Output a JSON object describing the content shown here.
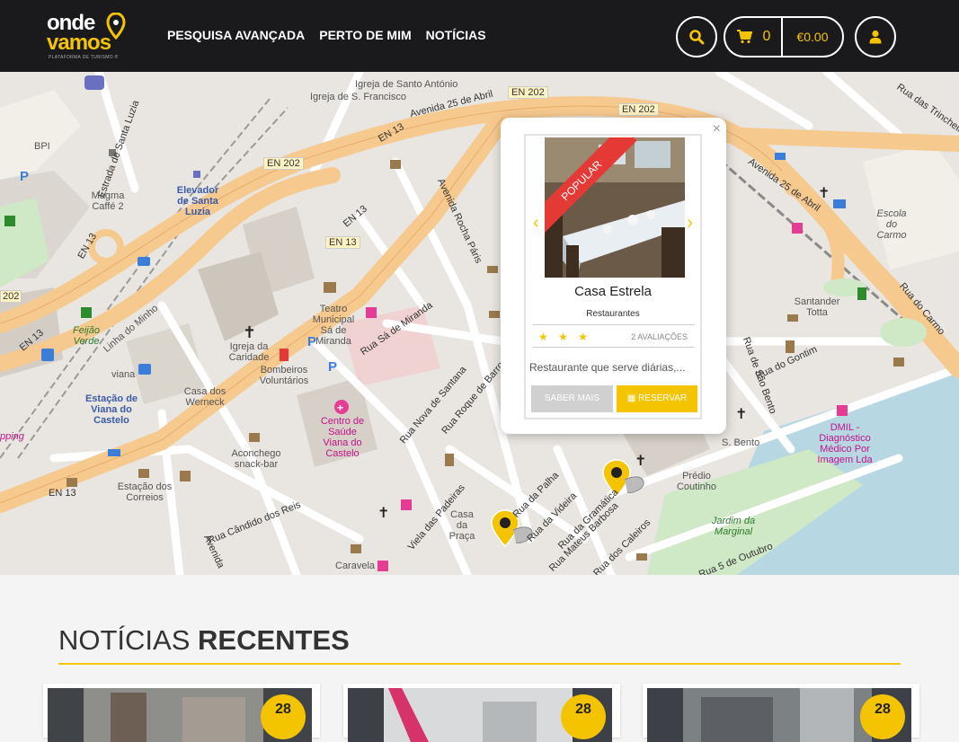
{
  "brand": {
    "line1": "onde",
    "line2": "vamos",
    "tagline": "PLATAFORMA DE TURISMO ®"
  },
  "nav": [
    {
      "label": "PESQUISA AVANÇADA"
    },
    {
      "label": "PERTO DE MIM"
    },
    {
      "label": "NOTÍCIAS"
    }
  ],
  "cart": {
    "count": "0",
    "total": "€0.00"
  },
  "icons": {
    "search": "search-icon",
    "cart": "cart-icon",
    "user": "user-icon"
  },
  "colors": {
    "accent": "#f5c400",
    "header": "#1a1a1c",
    "ribbon": "#e53935"
  },
  "map": {
    "labels": {
      "igreja_sf": "Igreja de S. Francisco",
      "igreja_sa": "Igreja de Santo António",
      "av25": "Avenida 25 de Abril",
      "en202a": "EN 202",
      "en202b": "EN 202",
      "en202c": "EN 202",
      "en13a": "EN 13",
      "en13b": "EN 13",
      "en13c": "EN 13",
      "en13d": "EN 13",
      "en13e": "EN 13",
      "en13f": "EN 13",
      "estrada": "Estrada de Santa Luzia",
      "bpi": "BPI",
      "magma": "Magma Caffé 2",
      "elevador": "Elevador de Santa Luzia",
      "teatro": "Teatro Municipal Sá de Miranda",
      "rua_sa": "Rua Sá de Miranda",
      "igreja_caridade": "Igreja da Caridade",
      "bombeiros": "Bombeiros Voluntários",
      "casa_werneck": "Casa dos Werneck",
      "centro_saude": "Centro de Saúde Viana do Castelo",
      "estacao": "Estação de Viana do Castelo",
      "viana": "viana",
      "feijao": "Feijão Verde",
      "linha": "Linha do Minho",
      "aconchego": "Aconchego snack-bar",
      "correios": "Estação dos Correios",
      "candido": "Rua Cândido dos Reis",
      "avenida_rocha": "Avenida Rocha Páris",
      "nova_santana": "Rua Nova de Santana",
      "roque": "Rua Roque de Barros",
      "padeiras": "Viela das Padeiras",
      "casa_praca": "Casa da Praça",
      "palha": "Rua da Palha",
      "videira": "Rua da Videira",
      "gramatica": "Rua da Gramática",
      "barbosa": "Rua Mateus Barbosa",
      "caleiros": "Rua dos Caleiros",
      "caravela": "Caravela",
      "predio": "Prédio Coutinho",
      "jardim": "Jardim da Marginal",
      "outubro": "Rua 5 de Outubro",
      "sao_bento": "Rua de São Bento",
      "s_bento": "S. Bento",
      "gontim": "Rua do Gontim",
      "santander": "Santander Totta",
      "dmil": "DMIL - Diagnóstico Médico Por Imagem Lda",
      "escola": "Escola do Carmo",
      "carmo": "Rua do Carmo",
      "trincheiras": "Rua das Trincheiras",
      "av25b": "Avenida 25 de Abril",
      "shopping": "pping",
      "two02": "202",
      "avenida": "Avenida"
    }
  },
  "popup": {
    "ribbon": "POPULAR",
    "title": "Casa Estrela",
    "category": "Restaurantes",
    "stars": "★ ★ ★",
    "rating_value": 3,
    "reviews": "2 AVALIAÇÕES",
    "description": "Restaurante que serve diárias,...",
    "btn_more": "SABER MAIS",
    "btn_book": "RESERVAR"
  },
  "news": {
    "title_light": "NOTÍCIAS ",
    "title_bold": "RECENTES",
    "cards": [
      {
        "badge": "28"
      },
      {
        "badge": "28"
      },
      {
        "badge": "28"
      }
    ]
  }
}
